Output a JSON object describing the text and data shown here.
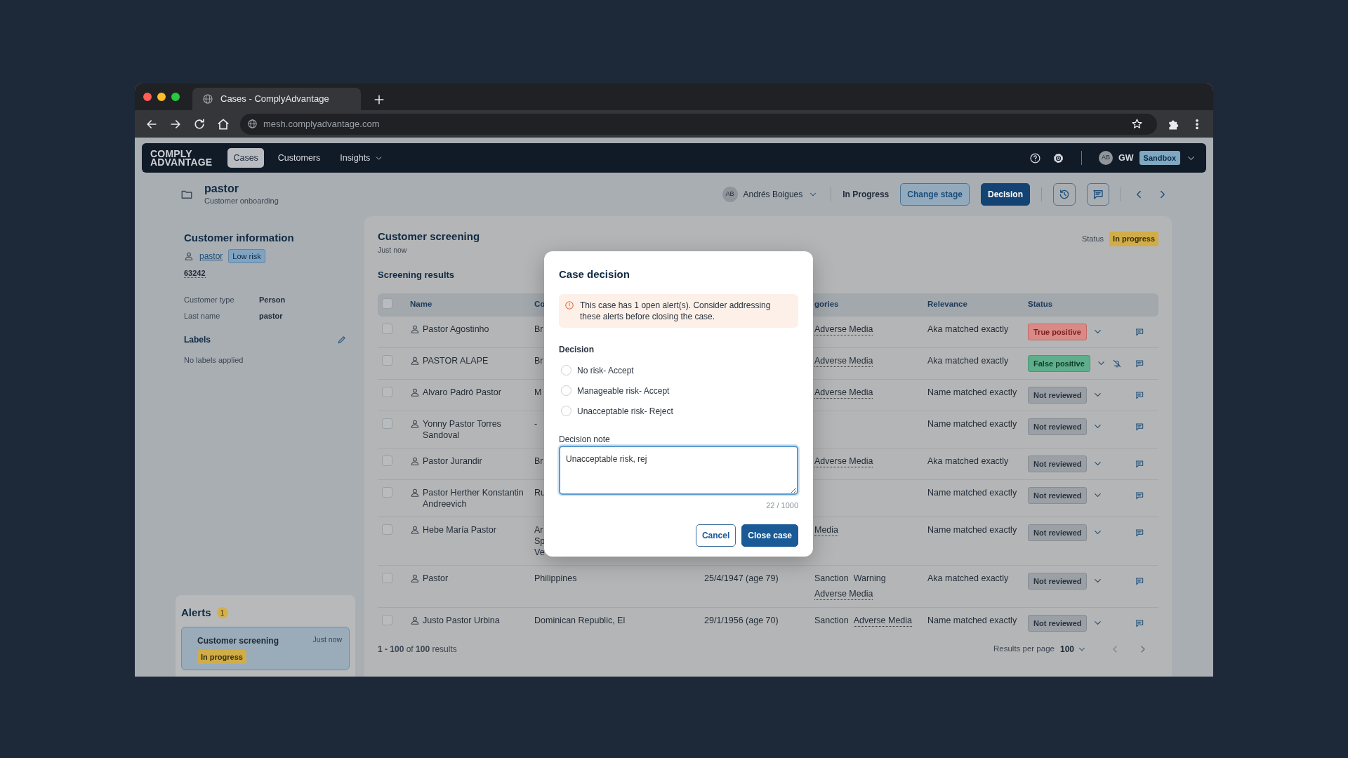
{
  "browser": {
    "tab_title": "Cases - ComplyAdvantage",
    "url": "mesh.complyadvantage.com"
  },
  "nav": {
    "logo_lines": [
      "COMPLY",
      "ADVANTAGE"
    ],
    "items": [
      {
        "label": "Cases",
        "selected": true,
        "dropdown": false
      },
      {
        "label": "Customers",
        "selected": false,
        "dropdown": false
      },
      {
        "label": "Insights",
        "selected": false,
        "dropdown": true
      }
    ],
    "user": {
      "initials": "AB",
      "name": "GW",
      "environment": "Sandbox"
    }
  },
  "case": {
    "title": "pastor",
    "subtitle": "Customer onboarding",
    "assignee_initials": "AB",
    "assignee": "Andrés Boigues",
    "stage": "In Progress",
    "buttons": [
      {
        "label": "Change stage",
        "kind": "secondary"
      },
      {
        "label": "Decision",
        "kind": "primary"
      }
    ]
  },
  "customer_info": {
    "title": "Customer information",
    "name": "pastor",
    "risk": "Low risk",
    "id": "63242",
    "fields": [
      {
        "label": "Customer type",
        "value": "Person"
      },
      {
        "label": "Last name",
        "value": "pastor"
      }
    ],
    "labels_title": "Labels",
    "labels_empty": "No labels applied"
  },
  "alerts": {
    "title": "Alerts",
    "count": "1",
    "items": [
      {
        "title": "Customer screening",
        "time": "Just now",
        "status": "In progress"
      }
    ]
  },
  "screening": {
    "title": "Customer screening",
    "time": "Just now",
    "status_label": "Status",
    "status": "In progress",
    "results_title": "Screening results",
    "select_all_checked": false,
    "columns": {
      "name": "Name",
      "country": "Co",
      "categories": "gories",
      "relevance": "Relevance",
      "status": "Status"
    },
    "rows": [
      {
        "checked": false,
        "name": "Pastor Agostinho",
        "country": [
          "Br"
        ],
        "categories": [
          {
            "text": "Adverse Media",
            "underlined": true
          }
        ],
        "relevance": "Aka matched exactly",
        "status": {
          "label": "True positive",
          "kind": "true_positive"
        },
        "alerts_muted": false
      },
      {
        "checked": false,
        "name": "PASTOR ALAPE",
        "country": [
          "Br"
        ],
        "categories": [
          {
            "text": "Adverse Media",
            "underlined": true
          }
        ],
        "relevance": "Aka matched exactly",
        "status": {
          "label": "False positive",
          "kind": "false_positive"
        },
        "alerts_muted": true
      },
      {
        "checked": false,
        "name": "Alvaro Padró Pastor",
        "country": [
          "M"
        ],
        "categories": [
          {
            "text": "Adverse Media",
            "underlined": true
          }
        ],
        "relevance": "Name matched exactly",
        "status": {
          "label": "Not reviewed",
          "kind": "not_reviewed"
        },
        "alerts_muted": false
      },
      {
        "checked": false,
        "name": "Yonny Pastor Torres Sandoval",
        "country": [
          "-"
        ],
        "categories": [],
        "relevance": "Name matched exactly",
        "status": {
          "label": "Not reviewed",
          "kind": "not_reviewed"
        },
        "alerts_muted": false
      },
      {
        "checked": false,
        "name": "Pastor Jurandir",
        "country": [
          "Br"
        ],
        "categories": [
          {
            "text": "Adverse Media",
            "underlined": true
          }
        ],
        "relevance": "Aka matched exactly",
        "status": {
          "label": "Not reviewed",
          "kind": "not_reviewed"
        },
        "alerts_muted": false
      },
      {
        "checked": false,
        "name": "Pastor Herther Konstantin Andreevich",
        "country": [
          "Ru"
        ],
        "categories": [],
        "relevance": "Name matched exactly",
        "status": {
          "label": "Not reviewed",
          "kind": "not_reviewed"
        },
        "alerts_muted": false
      },
      {
        "checked": false,
        "name": "Hebe María Pastor",
        "country": [
          "Ar",
          "Sp",
          "Ve"
        ],
        "categories": [
          {
            "text": "Media",
            "underlined": true
          }
        ],
        "relevance": "Name matched exactly",
        "status": {
          "label": "Not reviewed",
          "kind": "not_reviewed"
        },
        "alerts_muted": false
      },
      {
        "checked": false,
        "name": "Pastor",
        "country": [
          "Philippines"
        ],
        "dob": "25/4/1947 (age 79)",
        "categories": [
          {
            "text": "Sanction",
            "underlined": false
          },
          {
            "text": "Warning",
            "underlined": false
          },
          {
            "text": "Adverse Media",
            "underlined": true
          }
        ],
        "relevance": "Aka matched exactly",
        "status": {
          "label": "Not reviewed",
          "kind": "not_reviewed"
        },
        "alerts_muted": false
      },
      {
        "checked": false,
        "name": "Justo Pastor Urbina",
        "country": [
          "Dominican Republic, El"
        ],
        "dob": "29/1/1956 (age 70)",
        "categories": [
          {
            "text": "Sanction",
            "underlined": false
          },
          {
            "text": "Adverse Media",
            "underlined": true
          }
        ],
        "relevance": "Name matched exactly",
        "status": {
          "label": "Not reviewed",
          "kind": "not_reviewed"
        },
        "alerts_muted": false
      }
    ],
    "summary": "**1 - 100** of **100** results",
    "per_page_label": "Results per page",
    "per_page": "100"
  },
  "modal": {
    "title": "Case decision",
    "warning": "This case has 1 open alert(s). Consider addressing these alerts before closing the case.",
    "decision_label": "Decision",
    "options": [
      {
        "label": "No risk- Accept",
        "selected": false
      },
      {
        "label": "Manageable risk- Accept",
        "selected": false
      },
      {
        "label": "Unacceptable risk- Reject",
        "selected": false
      }
    ],
    "note_label": "Decision note",
    "note_value": "Unacceptable risk, rej",
    "counter": "22 / 1000",
    "buttons": [
      {
        "label": "Cancel",
        "kind": "secondary"
      },
      {
        "label": "Close case",
        "kind": "primary"
      }
    ]
  }
}
